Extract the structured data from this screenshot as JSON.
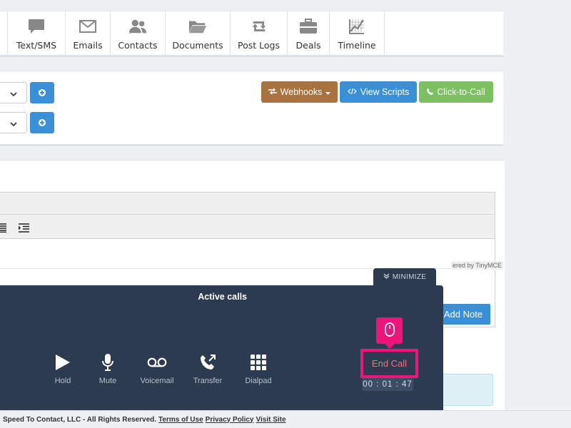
{
  "tabs": [
    {
      "label": "Text/SMS",
      "icon": "chat-bubble-icon"
    },
    {
      "label": "Emails",
      "icon": "envelope-icon"
    },
    {
      "label": "Contacts",
      "icon": "users-icon"
    },
    {
      "label": "Documents",
      "icon": "folder-icon"
    },
    {
      "label": "Post Logs",
      "icon": "retweet-icon"
    },
    {
      "label": "Deals",
      "icon": "briefcase-icon"
    },
    {
      "label": "Timeline",
      "icon": "chart-icon"
    }
  ],
  "actions": {
    "webhooks_label": "Webhooks",
    "scripts_label": "View Scripts",
    "call_label": "Click-to-Call"
  },
  "editor": {
    "powered_by": "ered by TinyMCE",
    "add_note_label": "Add Note"
  },
  "call_widget": {
    "minimize_label": "MINIMIZE",
    "title": "Active calls",
    "controls": [
      {
        "label": "Hold",
        "icon": "play-icon"
      },
      {
        "label": "Mute",
        "icon": "microphone-icon"
      },
      {
        "label": "Voicemail",
        "icon": "voicemail-icon"
      },
      {
        "label": "Transfer",
        "icon": "phone-transfer-icon"
      },
      {
        "label": "Dialpad",
        "icon": "dialpad-icon"
      }
    ],
    "end_call_label": "End Call",
    "timer": "00 : 01 : 47"
  },
  "footer": {
    "text": "Speed To Contact, LLC - All Rights Reserved.",
    "terms_link": "Terms of Use",
    "privacy_link": "Privacy Policy",
    "visit_link": "Visit Site"
  },
  "colors": {
    "accent_blue": "#3a8fd9",
    "webhooks_brown": "#a8733f",
    "call_green": "#7dc062",
    "panel_dark": "#2c3b50",
    "highlight_pink": "#f0147a"
  }
}
